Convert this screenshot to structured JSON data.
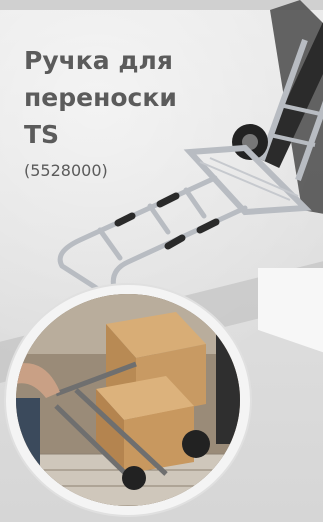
{
  "product": {
    "title_lines": [
      "Ручка для",
      "переноски",
      "TS"
    ],
    "code": "(5528000)"
  },
  "colors": {
    "text": "#5b5b5b",
    "background": "#e4e4e4",
    "metal": "#b8bcc2",
    "grip": "#2a2a2a",
    "box": "#c89a63"
  }
}
